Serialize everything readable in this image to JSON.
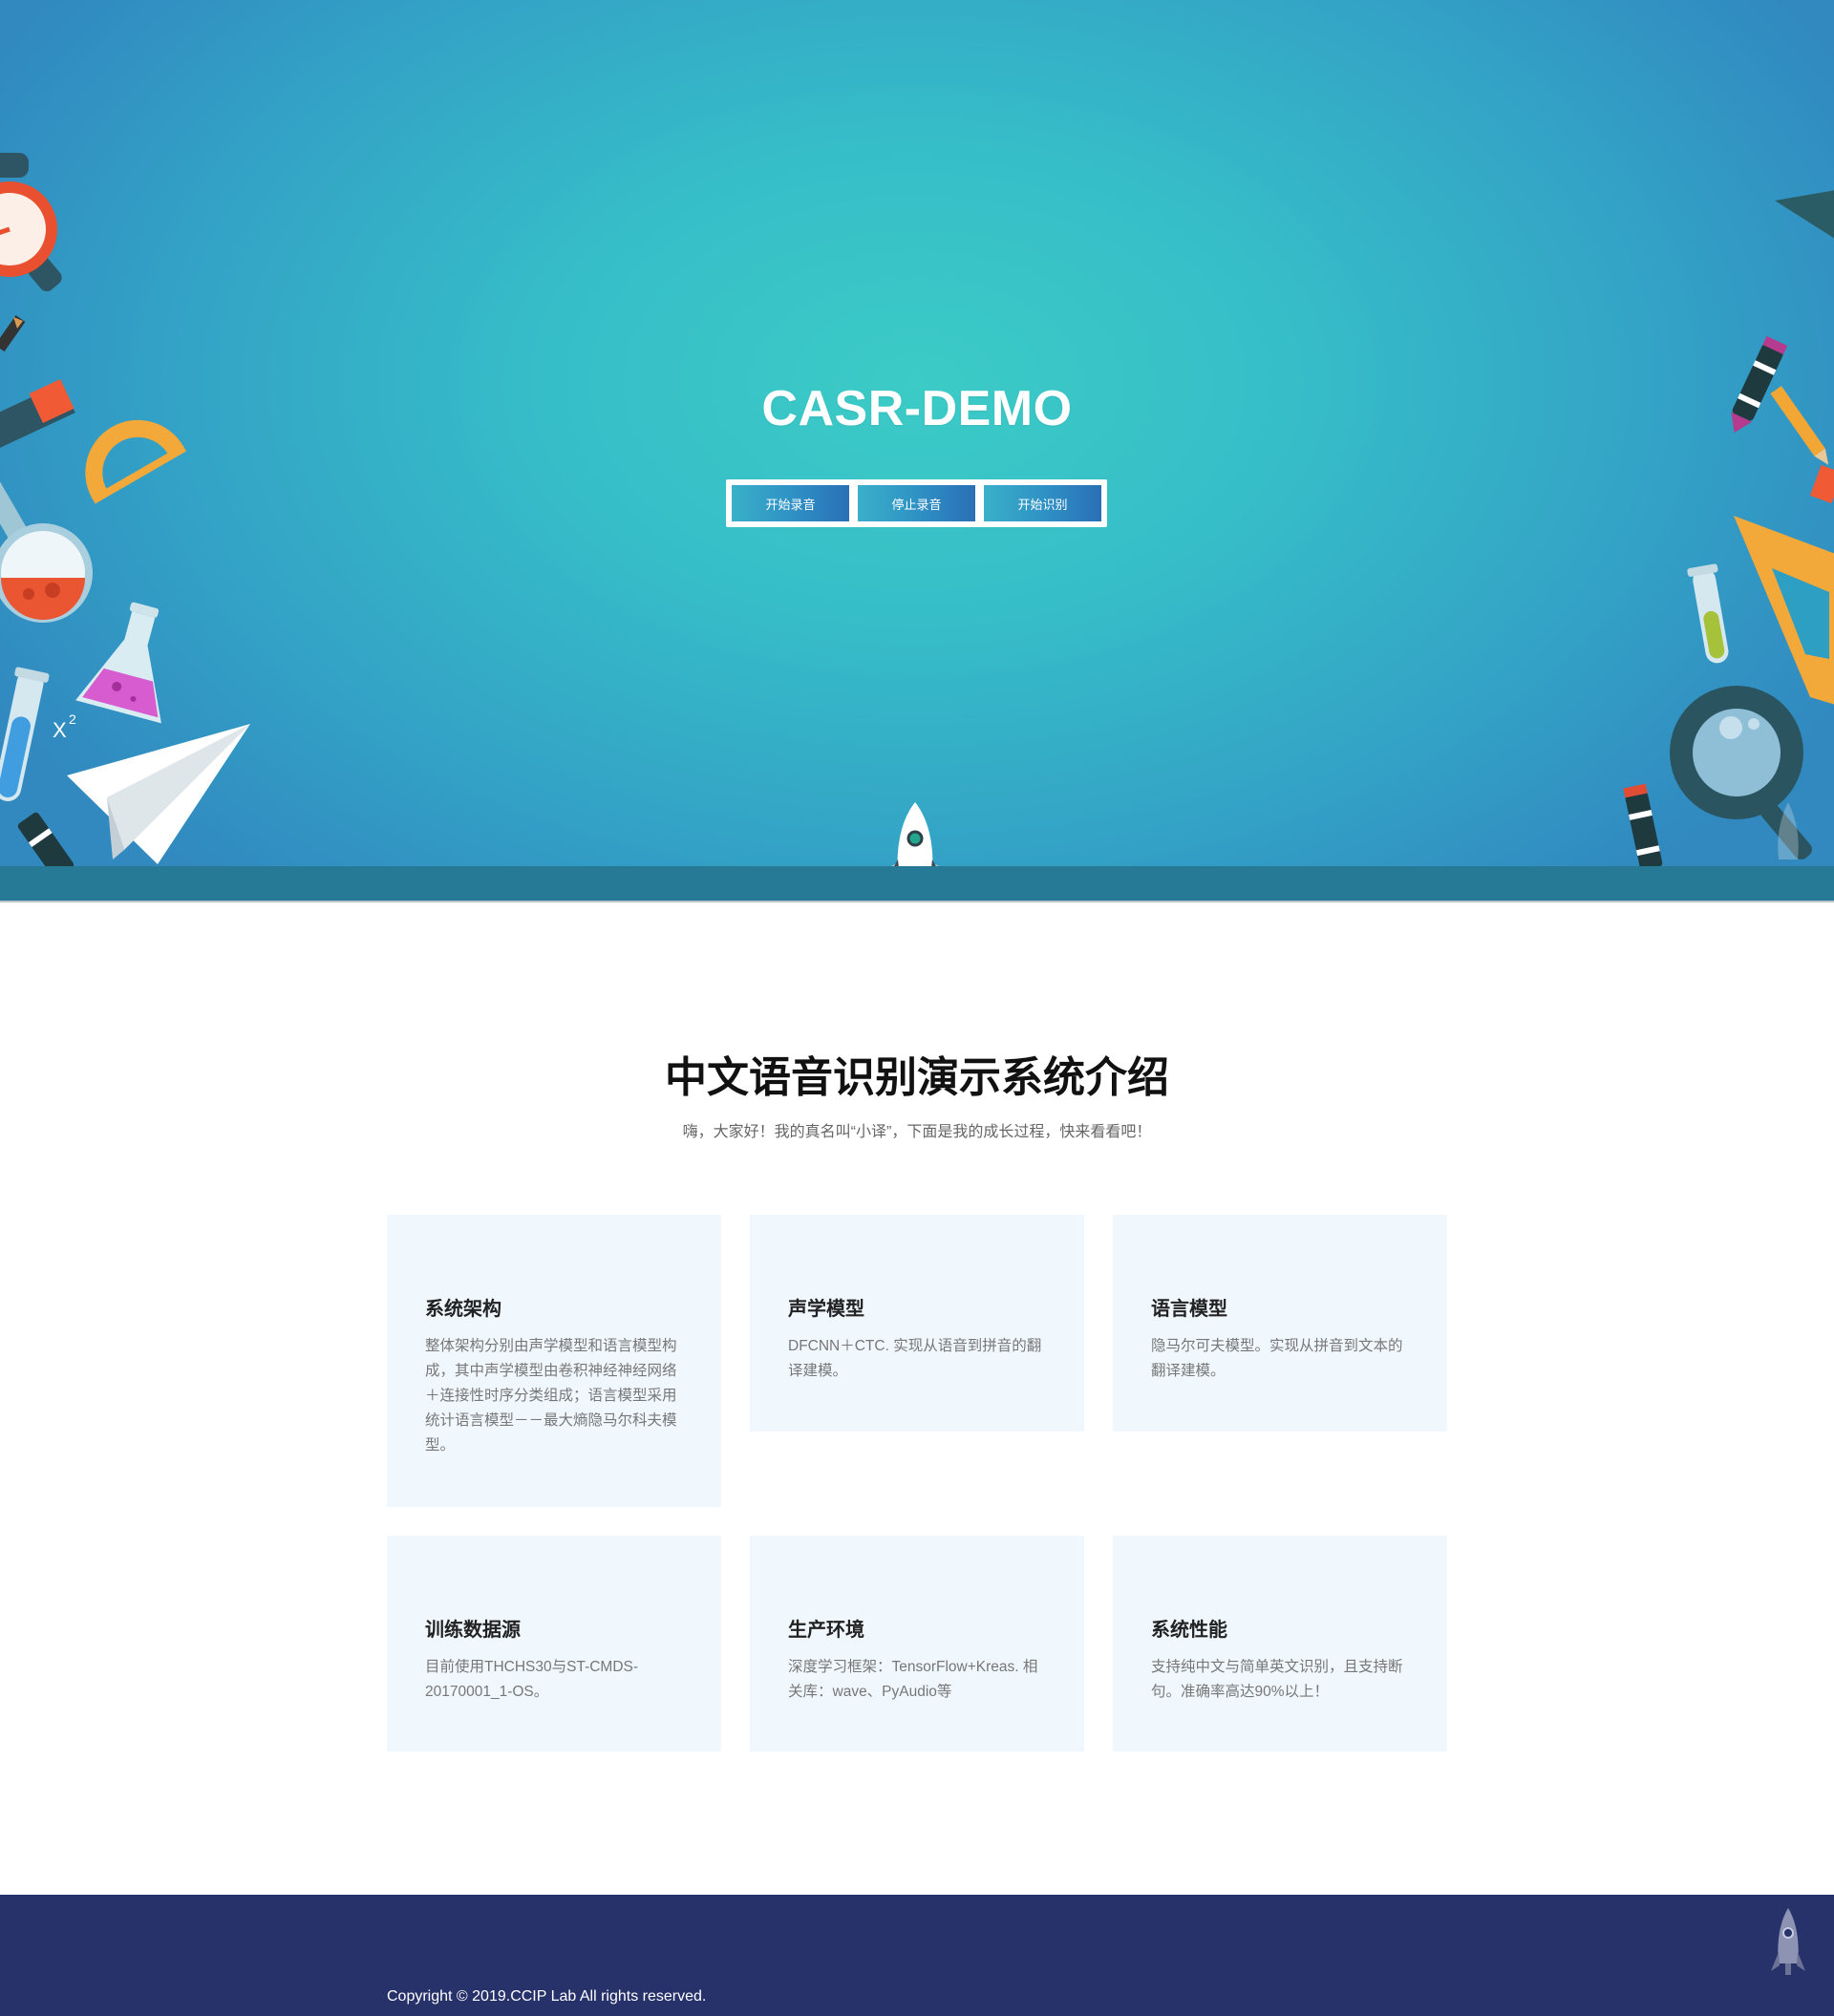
{
  "hero": {
    "title": "CASR-DEMO",
    "buttons": {
      "start_record": "开始录音",
      "stop_record": "停止录音",
      "start_recognize": "开始识别"
    },
    "decor_labels": {
      "formula_x": "X",
      "formula_sup": "2"
    }
  },
  "intro": {
    "title": "中文语音识别演示系统介绍",
    "subtitle": "嗨，大家好！我的真名叫“小译”，下面是我的成长过程，快来看看吧！",
    "cards": [
      {
        "title": "系统架构",
        "desc": "整体架构分别由声学模型和语言模型构成，其中声学模型由卷积神经神经网络＋连接性时序分类组成；语言模型采用统计语言模型－－最大熵隐马尔科夫模型。"
      },
      {
        "title": "声学模型",
        "desc": "DFCNN＋CTC. 实现从语音到拼音的翻译建模。"
      },
      {
        "title": "语言模型",
        "desc": "隐马尔可夫模型。实现从拼音到文本的翻译建模。"
      },
      {
        "title": "训练数据源",
        "desc": "目前使用THCHS30与ST-CMDS-20170001_1-OS。"
      },
      {
        "title": "生产环境",
        "desc": "深度学习框架：TensorFlow+Kreas. 相关库：wave、PyAudio等"
      },
      {
        "title": "系统性能",
        "desc": "支持纯中文与简单英文识别，且支持断句。准确率高达90%以上！"
      }
    ]
  },
  "footer": {
    "copyright": "Copyright © 2019.CCIP Lab All rights reserved."
  },
  "colors": {
    "hero_center": "#3ccbc6",
    "hero_edge": "#3189c0",
    "button": "#2e8fc4",
    "card_bg": "#f0f7fd",
    "footer_bg": "#27316a"
  },
  "icons": [
    "alarm-clock-icon",
    "flask-icon",
    "test-tube-icon",
    "paper-plane-icon",
    "protractor-icon",
    "crayon-icon",
    "pencil-icon",
    "triangle-ruler-icon",
    "magnifier-icon",
    "graduation-cap-icon",
    "rocket-icon"
  ]
}
